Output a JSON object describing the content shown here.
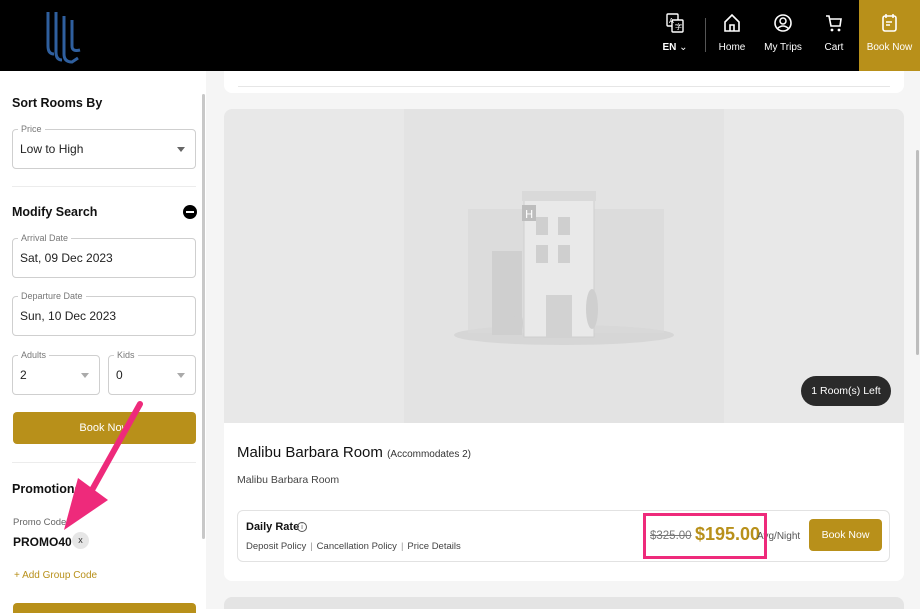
{
  "nav": {
    "lang": "EN",
    "home": "Home",
    "trips": "My Trips",
    "cart": "Cart",
    "book_now": "Book Now"
  },
  "sidebar": {
    "sort_title": "Sort Rooms By",
    "sort_label": "Price",
    "sort_value": "Low to High",
    "modify_title": "Modify Search",
    "arrival_label": "Arrival Date",
    "arrival_value": "Sat, 09 Dec 2023",
    "departure_label": "Departure Date",
    "departure_value": "Sun, 10 Dec 2023",
    "adults_label": "Adults",
    "adults_value": "2",
    "kids_label": "Kids",
    "kids_value": "0",
    "book_now": "Book Now",
    "promotions_title": "Promotions",
    "promo_label": "Promo Code:",
    "promo_value": "PROMO40",
    "promo_remove": "x",
    "group_code": "+ Add Group Code"
  },
  "room": {
    "rooms_left": "1 Room(s) Left",
    "name": "Malibu Barbara Room",
    "accommodates": "(Accommodates 2)",
    "description": "Malibu Barbara Room",
    "rate_title": "Daily Rate",
    "info": "i",
    "policy_deposit": "Deposit Policy",
    "policy_cancel": "Cancellation Policy",
    "policy_price": "Price Details",
    "old_price": "$325.00",
    "new_price": "$195.00",
    "per_night": "Avg/Night",
    "book_now": "Book Now"
  },
  "colors": {
    "brand_gold": "#b8901a",
    "topbar": "#000000",
    "annotation_pink": "#ee2a7b"
  }
}
